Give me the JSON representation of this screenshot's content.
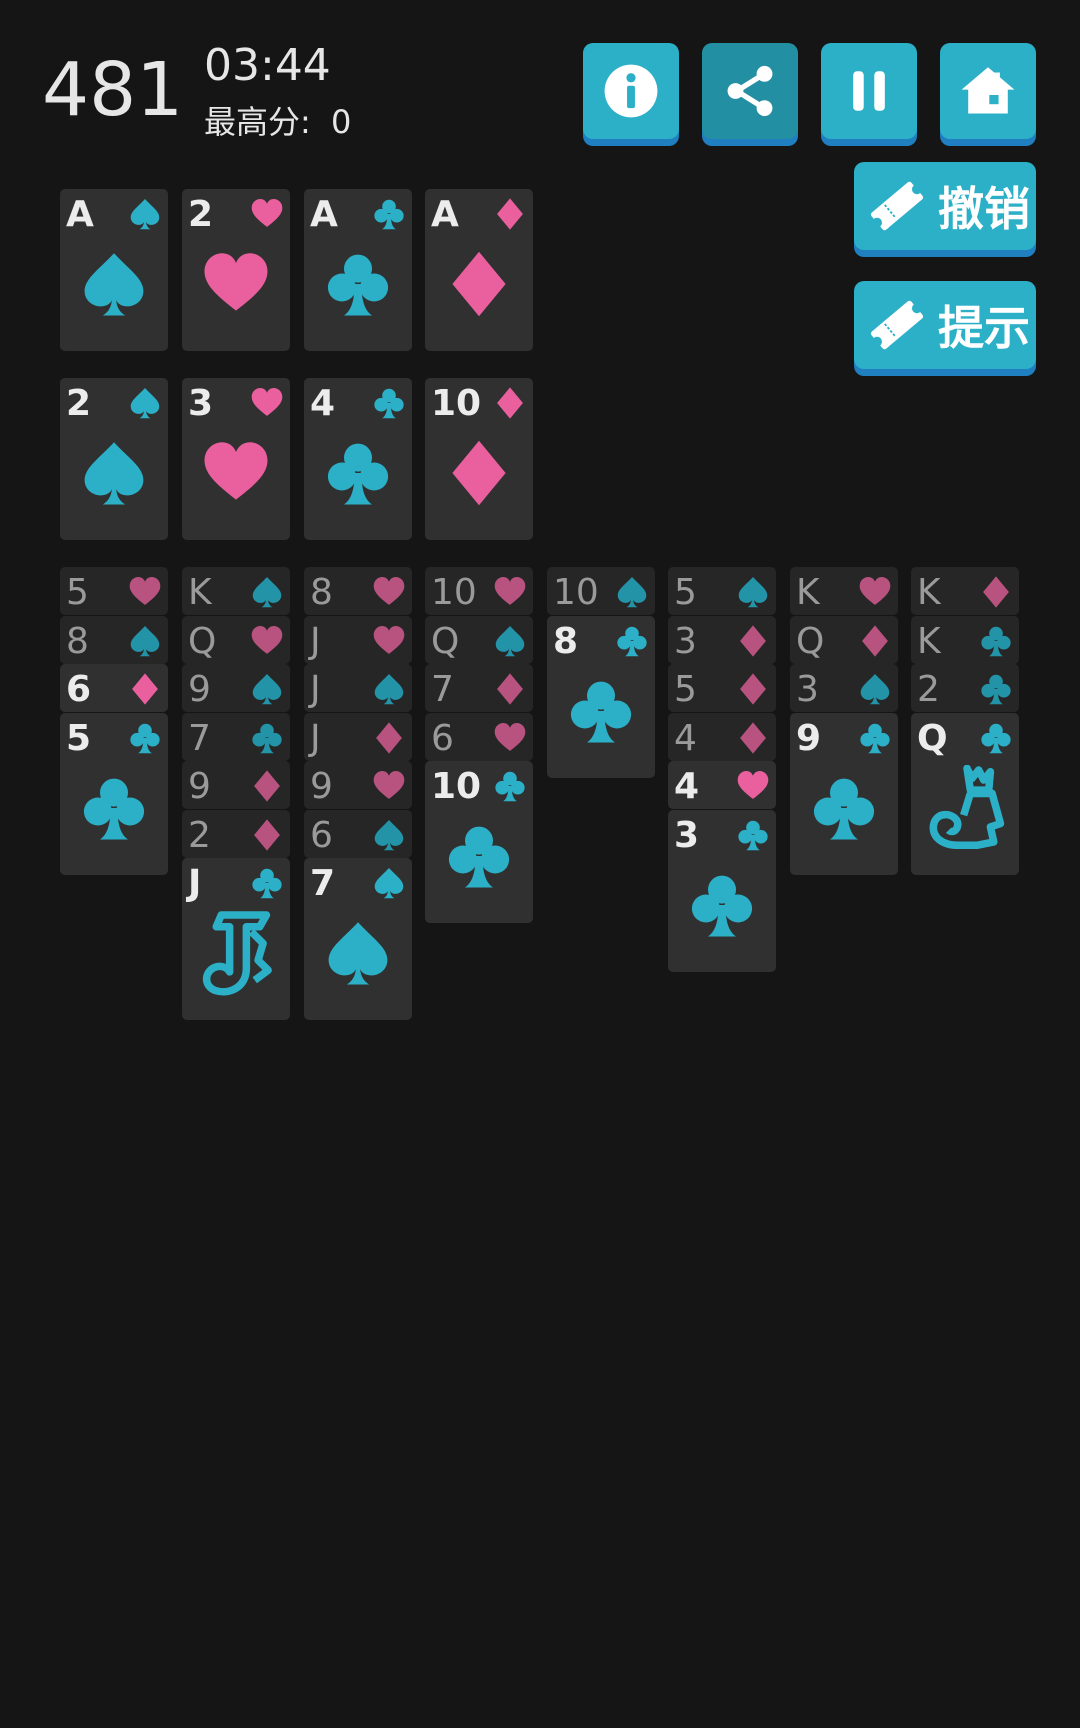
{
  "header": {
    "score": "481",
    "timer": "03:44",
    "best_label": "最高分:",
    "best_value": "0"
  },
  "buttons": {
    "info": "info-icon",
    "share": "share-icon",
    "pause": "pause-icon",
    "home": "home-icon",
    "undo_label": "撤销",
    "hint_label": "提示"
  },
  "colors": {
    "background": "#151515",
    "button": "#2bb0c8",
    "button_active": "#238fa3",
    "button_shadow": "#1f7fc0",
    "black_suit": "#2bb0c8",
    "red_suit": "#ea5f9e",
    "card": "#303030",
    "card_dim": "#262626"
  },
  "foundations": [
    {
      "rank": "A",
      "suit": "spade"
    },
    {
      "rank": "2",
      "suit": "heart"
    },
    {
      "rank": "A",
      "suit": "club"
    },
    {
      "rank": "A",
      "suit": "diamond"
    }
  ],
  "cells": [
    {
      "rank": "2",
      "suit": "spade"
    },
    {
      "rank": "3",
      "suit": "heart"
    },
    {
      "rank": "4",
      "suit": "club"
    },
    {
      "rank": "10",
      "suit": "diamond"
    }
  ],
  "tableau": [
    [
      {
        "rank": "5",
        "suit": "heart",
        "dim": true
      },
      {
        "rank": "8",
        "suit": "spade",
        "dim": true
      },
      {
        "rank": "6",
        "suit": "diamond",
        "dim": false
      },
      {
        "rank": "5",
        "suit": "club",
        "dim": false
      }
    ],
    [
      {
        "rank": "K",
        "suit": "spade",
        "dim": true
      },
      {
        "rank": "Q",
        "suit": "heart",
        "dim": true
      },
      {
        "rank": "9",
        "suit": "spade",
        "dim": true
      },
      {
        "rank": "7",
        "suit": "club",
        "dim": true
      },
      {
        "rank": "9",
        "suit": "diamond",
        "dim": true
      },
      {
        "rank": "2",
        "suit": "diamond",
        "dim": true
      },
      {
        "rank": "J",
        "suit": "club",
        "dim": false
      }
    ],
    [
      {
        "rank": "8",
        "suit": "heart",
        "dim": true
      },
      {
        "rank": "J",
        "suit": "heart",
        "dim": true
      },
      {
        "rank": "J",
        "suit": "spade",
        "dim": true
      },
      {
        "rank": "J",
        "suit": "diamond",
        "dim": true
      },
      {
        "rank": "9",
        "suit": "heart",
        "dim": true
      },
      {
        "rank": "6",
        "suit": "spade",
        "dim": true
      },
      {
        "rank": "7",
        "suit": "spade",
        "dim": false
      }
    ],
    [
      {
        "rank": "10",
        "suit": "heart",
        "dim": true
      },
      {
        "rank": "Q",
        "suit": "spade",
        "dim": true
      },
      {
        "rank": "7",
        "suit": "diamond",
        "dim": true
      },
      {
        "rank": "6",
        "suit": "heart",
        "dim": true
      },
      {
        "rank": "10",
        "suit": "club",
        "dim": false
      }
    ],
    [
      {
        "rank": "10",
        "suit": "spade",
        "dim": true
      },
      {
        "rank": "8",
        "suit": "club",
        "dim": false
      }
    ],
    [
      {
        "rank": "5",
        "suit": "spade",
        "dim": true
      },
      {
        "rank": "3",
        "suit": "diamond",
        "dim": true
      },
      {
        "rank": "5",
        "suit": "diamond",
        "dim": true
      },
      {
        "rank": "4",
        "suit": "diamond",
        "dim": true
      },
      {
        "rank": "4",
        "suit": "heart",
        "dim": false
      },
      {
        "rank": "3",
        "suit": "club",
        "dim": false
      }
    ],
    [
      {
        "rank": "K",
        "suit": "heart",
        "dim": true
      },
      {
        "rank": "Q",
        "suit": "diamond",
        "dim": true
      },
      {
        "rank": "3",
        "suit": "spade",
        "dim": true
      },
      {
        "rank": "9",
        "suit": "club",
        "dim": false
      }
    ],
    [
      {
        "rank": "K",
        "suit": "diamond",
        "dim": true
      },
      {
        "rank": "K",
        "suit": "club",
        "dim": true
      },
      {
        "rank": "2",
        "suit": "club",
        "dim": true
      },
      {
        "rank": "Q",
        "suit": "club",
        "dim": false
      }
    ]
  ]
}
